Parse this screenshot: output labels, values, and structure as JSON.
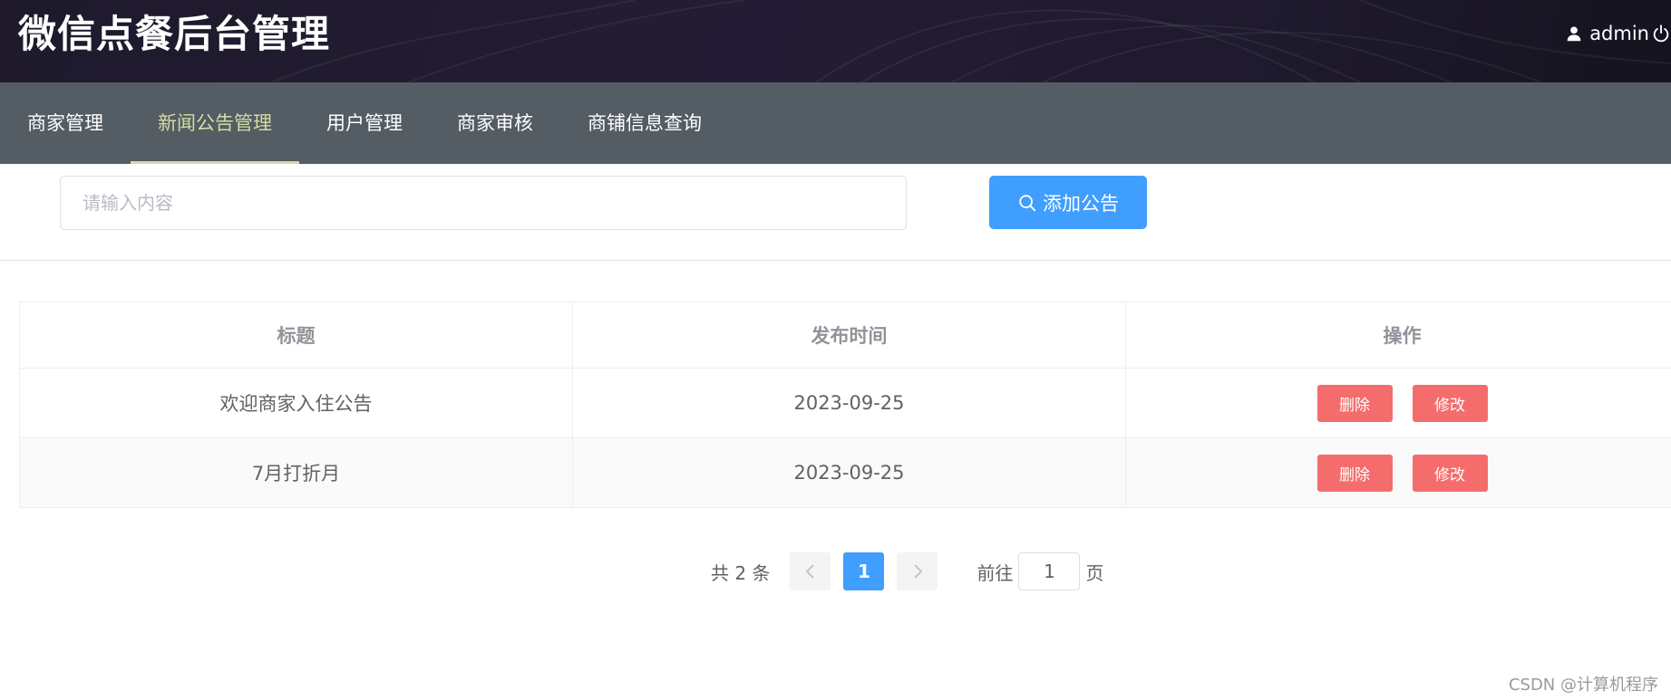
{
  "header": {
    "title": "微信点餐后台管理",
    "username": "admin",
    "icons": {
      "user": "user-icon",
      "logout": "power-icon"
    }
  },
  "nav": {
    "items": [
      {
        "label": "商家管理",
        "active": false
      },
      {
        "label": "新闻公告管理",
        "active": true
      },
      {
        "label": "用户管理",
        "active": false
      },
      {
        "label": "商家审核",
        "active": false
      },
      {
        "label": "商铺信息查询",
        "active": false
      }
    ]
  },
  "toolbar": {
    "search_placeholder": "请输入内容",
    "search_value": "",
    "add_label": "添加公告",
    "add_icon": "search-icon"
  },
  "table": {
    "columns": [
      "标题",
      "发布时间",
      "操作"
    ],
    "rows": [
      {
        "title": "欢迎商家入住公告",
        "date": "2023-09-25",
        "delete_label": "删除",
        "edit_label": "修改"
      },
      {
        "title": "7月打折月",
        "date": "2023-09-25",
        "delete_label": "删除",
        "edit_label": "修改"
      }
    ]
  },
  "pagination": {
    "total_text": "共 2 条",
    "current_page": "1",
    "goto_label": "前往",
    "goto_value": "1",
    "page_suffix": "页"
  },
  "watermark": "CSDN @计算机程序",
  "colors": {
    "header_bg": "#1e1a2c",
    "nav_bg": "#545c64",
    "nav_active": "#d3dca0",
    "primary": "#409eff",
    "danger": "#f56c6c"
  }
}
